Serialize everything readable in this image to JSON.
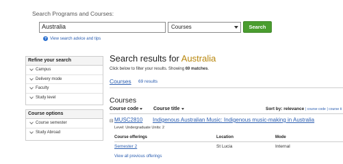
{
  "search": {
    "label": "Search Programs and Courses:",
    "query": "Australia",
    "scope": "Courses",
    "button_label": "Search",
    "advice_link": "View search advice and tips"
  },
  "sidebar": {
    "refine_title": "Refine your search",
    "refine_items": [
      "Campus",
      "Delivery mode",
      "Faculty",
      "Study level"
    ],
    "options_title": "Course options",
    "options_items": [
      "Course semester",
      "Study Abroad"
    ]
  },
  "results": {
    "title_prefix": "Search results for ",
    "title_term": "Australia",
    "subtitle_prefix": "Click below to filter your results. Showing ",
    "subtitle_count": "69 matches",
    "subtitle_suffix": ".",
    "tab_label": "Courses",
    "tab_count": "69 results"
  },
  "courses": {
    "heading": "Courses",
    "col_code": "Course code",
    "col_title": "Course title",
    "sort_label": "Sort by:",
    "sort_active": "relevance",
    "sort_opt1": "| course code",
    "sort_opt2": "| course ti",
    "items": [
      {
        "code": "MUSC2810",
        "title": "Indigenous Australian Music: Indigenous music-making in Australia",
        "meta": "Level: Undergraduate Units: 2"
      }
    ]
  },
  "offerings": {
    "col_offerings": "Course offerings",
    "col_location": "Location",
    "col_mode": "Mode",
    "rows": [
      {
        "semester": "Semester 2",
        "location": "St Lucia",
        "mode": "Internal"
      }
    ],
    "view_all": "View all previous offerings"
  },
  "colors": {
    "accent_link": "#2a5db0",
    "search_button": "#4a9d2f",
    "highlight_term": "#b8860b"
  }
}
